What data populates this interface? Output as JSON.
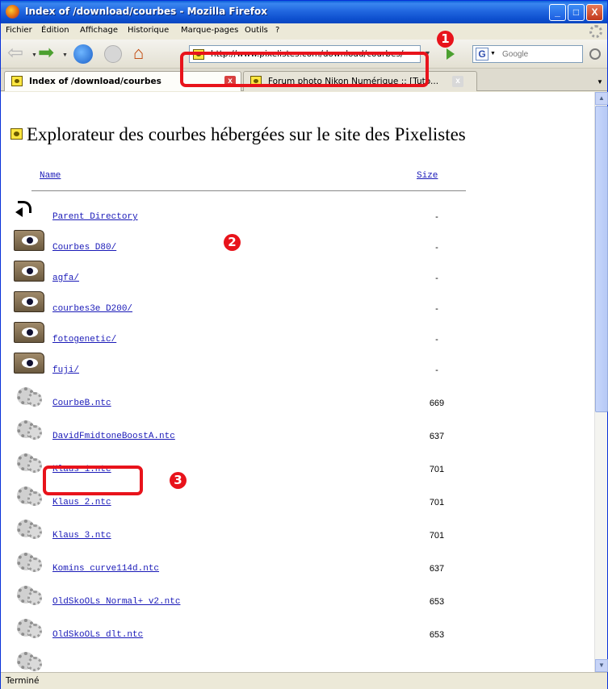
{
  "window": {
    "title": "Index of /download/courbes - Mozilla Firefox",
    "minimize": "_",
    "maximize": "□",
    "close": "X"
  },
  "menu": [
    {
      "label": "Fichier"
    },
    {
      "label": "Édition"
    },
    {
      "label": "Affichage"
    },
    {
      "label": "Historique"
    },
    {
      "label": "Marque-pages"
    },
    {
      "label": "Outils"
    },
    {
      "label": "?"
    }
  ],
  "nav": {
    "url": "http://www.pixelistes.com/download/courbes/",
    "search_placeholder": "Google",
    "search_engine_letter": "G"
  },
  "tabs": [
    {
      "label": "Index of /download/courbes",
      "active": true
    },
    {
      "label": "Forum photo Nikon Numérique :: [Tuto...",
      "active": false
    }
  ],
  "page": {
    "heading": "Explorateur des courbes hébergées sur le site des Pixelistes",
    "col_name": "Name",
    "col_size": "Size",
    "entries": [
      {
        "name": "Parent Directory",
        "size": "-",
        "icon": "back-arrow-icon"
      },
      {
        "name": "Courbes D80/",
        "size": "-",
        "icon": "folder-icon"
      },
      {
        "name": "agfa/",
        "size": "-",
        "icon": "folder-icon"
      },
      {
        "name": "courbes3e D200/",
        "size": "-",
        "icon": "folder-icon"
      },
      {
        "name": "fotogenetic/",
        "size": "-",
        "icon": "folder-icon"
      },
      {
        "name": "fuji/",
        "size": "-",
        "icon": "folder-icon"
      },
      {
        "name": "CourbeB.ntc",
        "size": "669",
        "icon": "gear-file-icon"
      },
      {
        "name": "DavidFmidtoneBoostA.ntc",
        "size": "637",
        "icon": "gear-file-icon"
      },
      {
        "name": "Klaus 1.ntc",
        "size": "701",
        "icon": "gear-file-icon"
      },
      {
        "name": "Klaus 2.ntc",
        "size": "701",
        "icon": "gear-file-icon"
      },
      {
        "name": "Klaus 3.ntc",
        "size": "701",
        "icon": "gear-file-icon"
      },
      {
        "name": "Komins curve114d.ntc",
        "size": "637",
        "icon": "gear-file-icon"
      },
      {
        "name": "OldSkoOLs Normal+ v2.ntc",
        "size": "653",
        "icon": "gear-file-icon"
      },
      {
        "name": "OldSkoOLs dlt.ntc",
        "size": "653",
        "icon": "gear-file-icon"
      }
    ]
  },
  "callouts": [
    {
      "number": "1"
    },
    {
      "number": "2"
    },
    {
      "number": "3"
    }
  ],
  "status": {
    "text": "Terminé"
  },
  "colors": {
    "callout": "#e8131b",
    "link": "#1a1ab8",
    "titlebar": "#2167e0"
  }
}
